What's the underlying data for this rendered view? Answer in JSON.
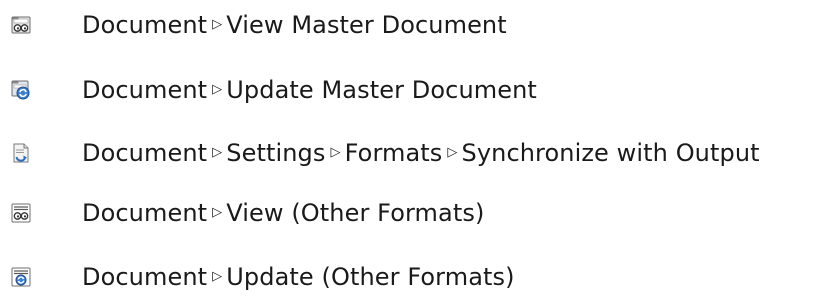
{
  "separator_glyph": "▷",
  "menu": {
    "items": [
      {
        "icon": "view-master-document-icon",
        "segments": [
          "Document",
          "View Master Document"
        ]
      },
      {
        "icon": "update-master-document-icon",
        "segments": [
          "Document",
          "Update Master Document"
        ]
      },
      {
        "icon": "synchronize-with-output-icon",
        "segments": [
          "Document",
          "Settings",
          "Formats",
          "Synchronize with Output"
        ]
      },
      {
        "icon": "view-other-formats-icon",
        "segments": [
          "Document",
          "View (Other Formats)"
        ]
      },
      {
        "icon": "update-other-formats-icon",
        "segments": [
          "Document",
          "Update (Other Formats)"
        ]
      }
    ]
  }
}
